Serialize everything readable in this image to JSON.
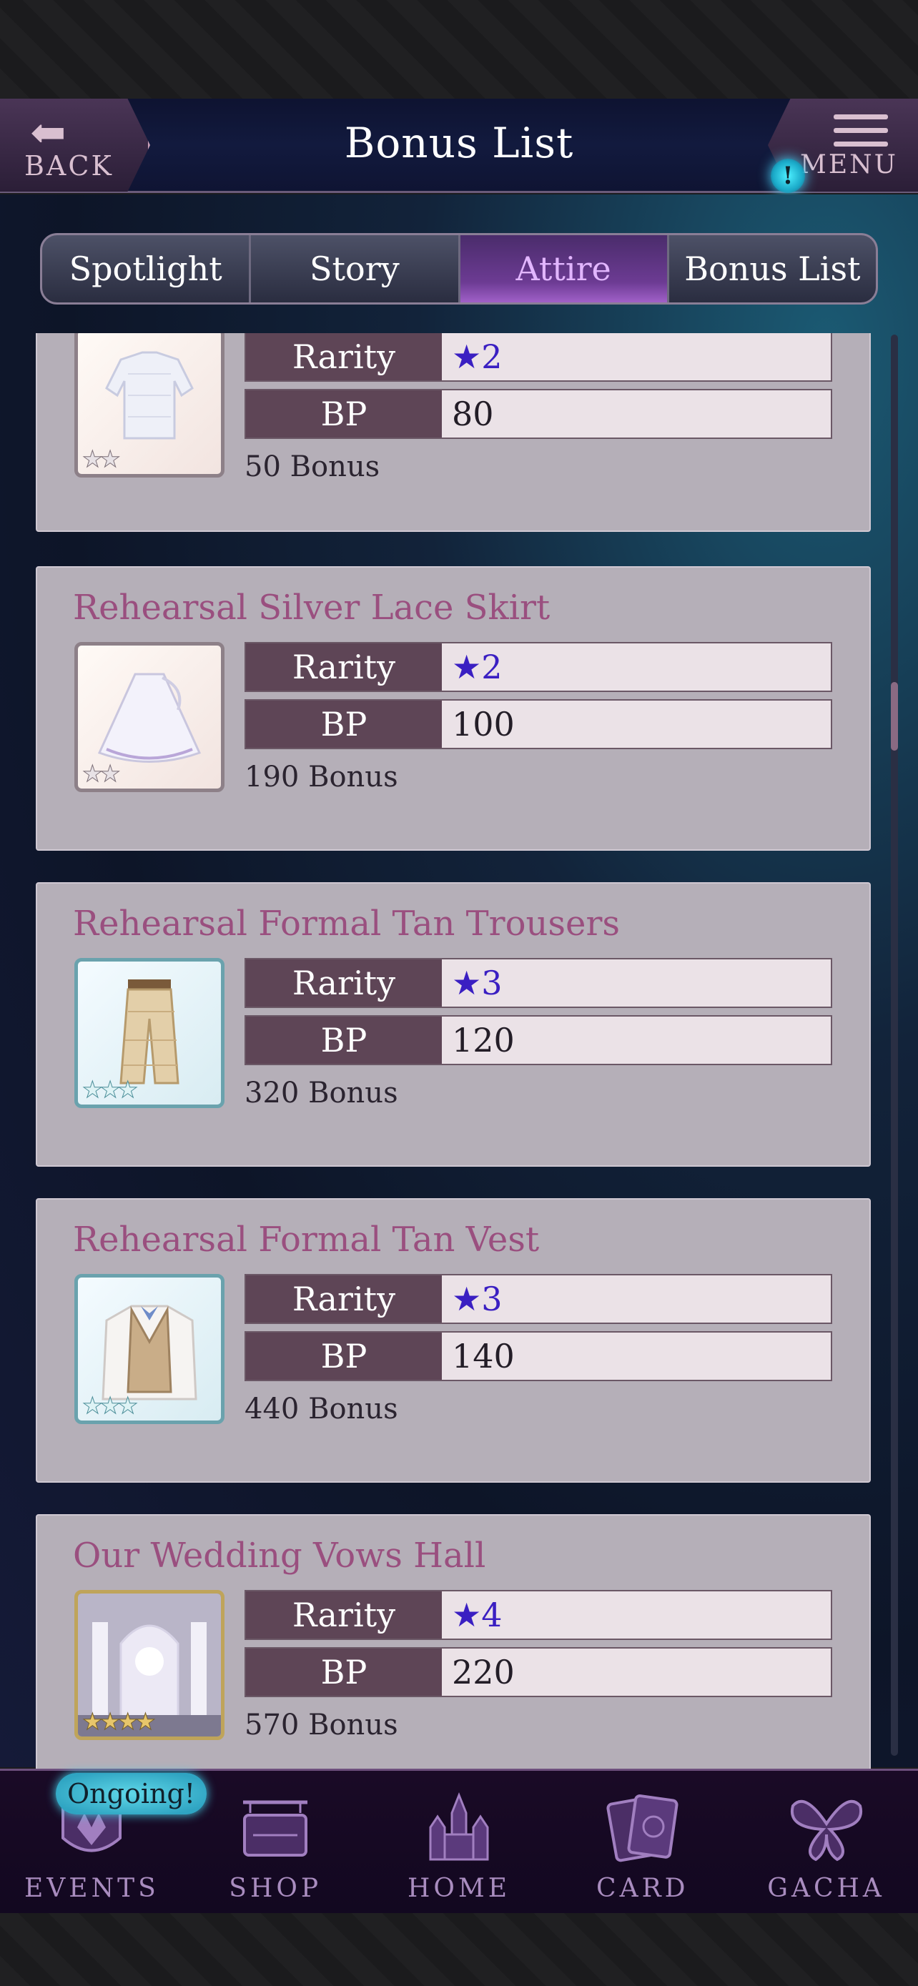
{
  "header": {
    "title": "Bonus List",
    "back_label": "BACK",
    "menu_label": "MENU",
    "notice": "!"
  },
  "tabs": [
    {
      "label": "Spotlight",
      "active": false
    },
    {
      "label": "Story",
      "active": false
    },
    {
      "label": "Attire",
      "active": true
    },
    {
      "label": "Bonus List",
      "active": false
    }
  ],
  "labels": {
    "rarity": "Rarity",
    "bp": "BP"
  },
  "items": [
    {
      "title": "",
      "rarity": "★2",
      "bp": "80",
      "bonus": "50 Bonus",
      "thumb_stars": "★★",
      "thumb_icon": "lace-blouse-icon"
    },
    {
      "title": "Rehearsal Silver Lace Skirt",
      "rarity": "★2",
      "bp": "100",
      "bonus": "190 Bonus",
      "thumb_stars": "★★",
      "thumb_icon": "lace-skirt-icon"
    },
    {
      "title": "Rehearsal Formal Tan Trousers",
      "rarity": "★3",
      "bp": "120",
      "bonus": "320 Bonus",
      "thumb_stars": "★★★",
      "thumb_icon": "trousers-icon"
    },
    {
      "title": "Rehearsal Formal Tan Vest",
      "rarity": "★3",
      "bp": "140",
      "bonus": "440 Bonus",
      "thumb_stars": "★★★",
      "thumb_icon": "vest-icon"
    },
    {
      "title": "Our Wedding Vows Hall",
      "rarity": "★4",
      "bp": "220",
      "bonus": "570 Bonus",
      "thumb_stars": "★★★★",
      "thumb_icon": "wedding-hall-icon"
    }
  ],
  "bottom_nav": {
    "ongoing_badge": "Ongoing!",
    "items": [
      {
        "label": "EVENTS",
        "icon": "crest-icon"
      },
      {
        "label": "SHOP",
        "icon": "shop-sign-icon"
      },
      {
        "label": "HOME",
        "icon": "castle-icon"
      },
      {
        "label": "CARD",
        "icon": "cards-icon"
      },
      {
        "label": "GACHA",
        "icon": "butterfly-icon"
      }
    ]
  },
  "colors": {
    "title_pink": "#9a4f7f",
    "rarity_star": "#3a1fc2",
    "active_tab": "#e2b6ff",
    "label_bg": "#5e4556"
  }
}
